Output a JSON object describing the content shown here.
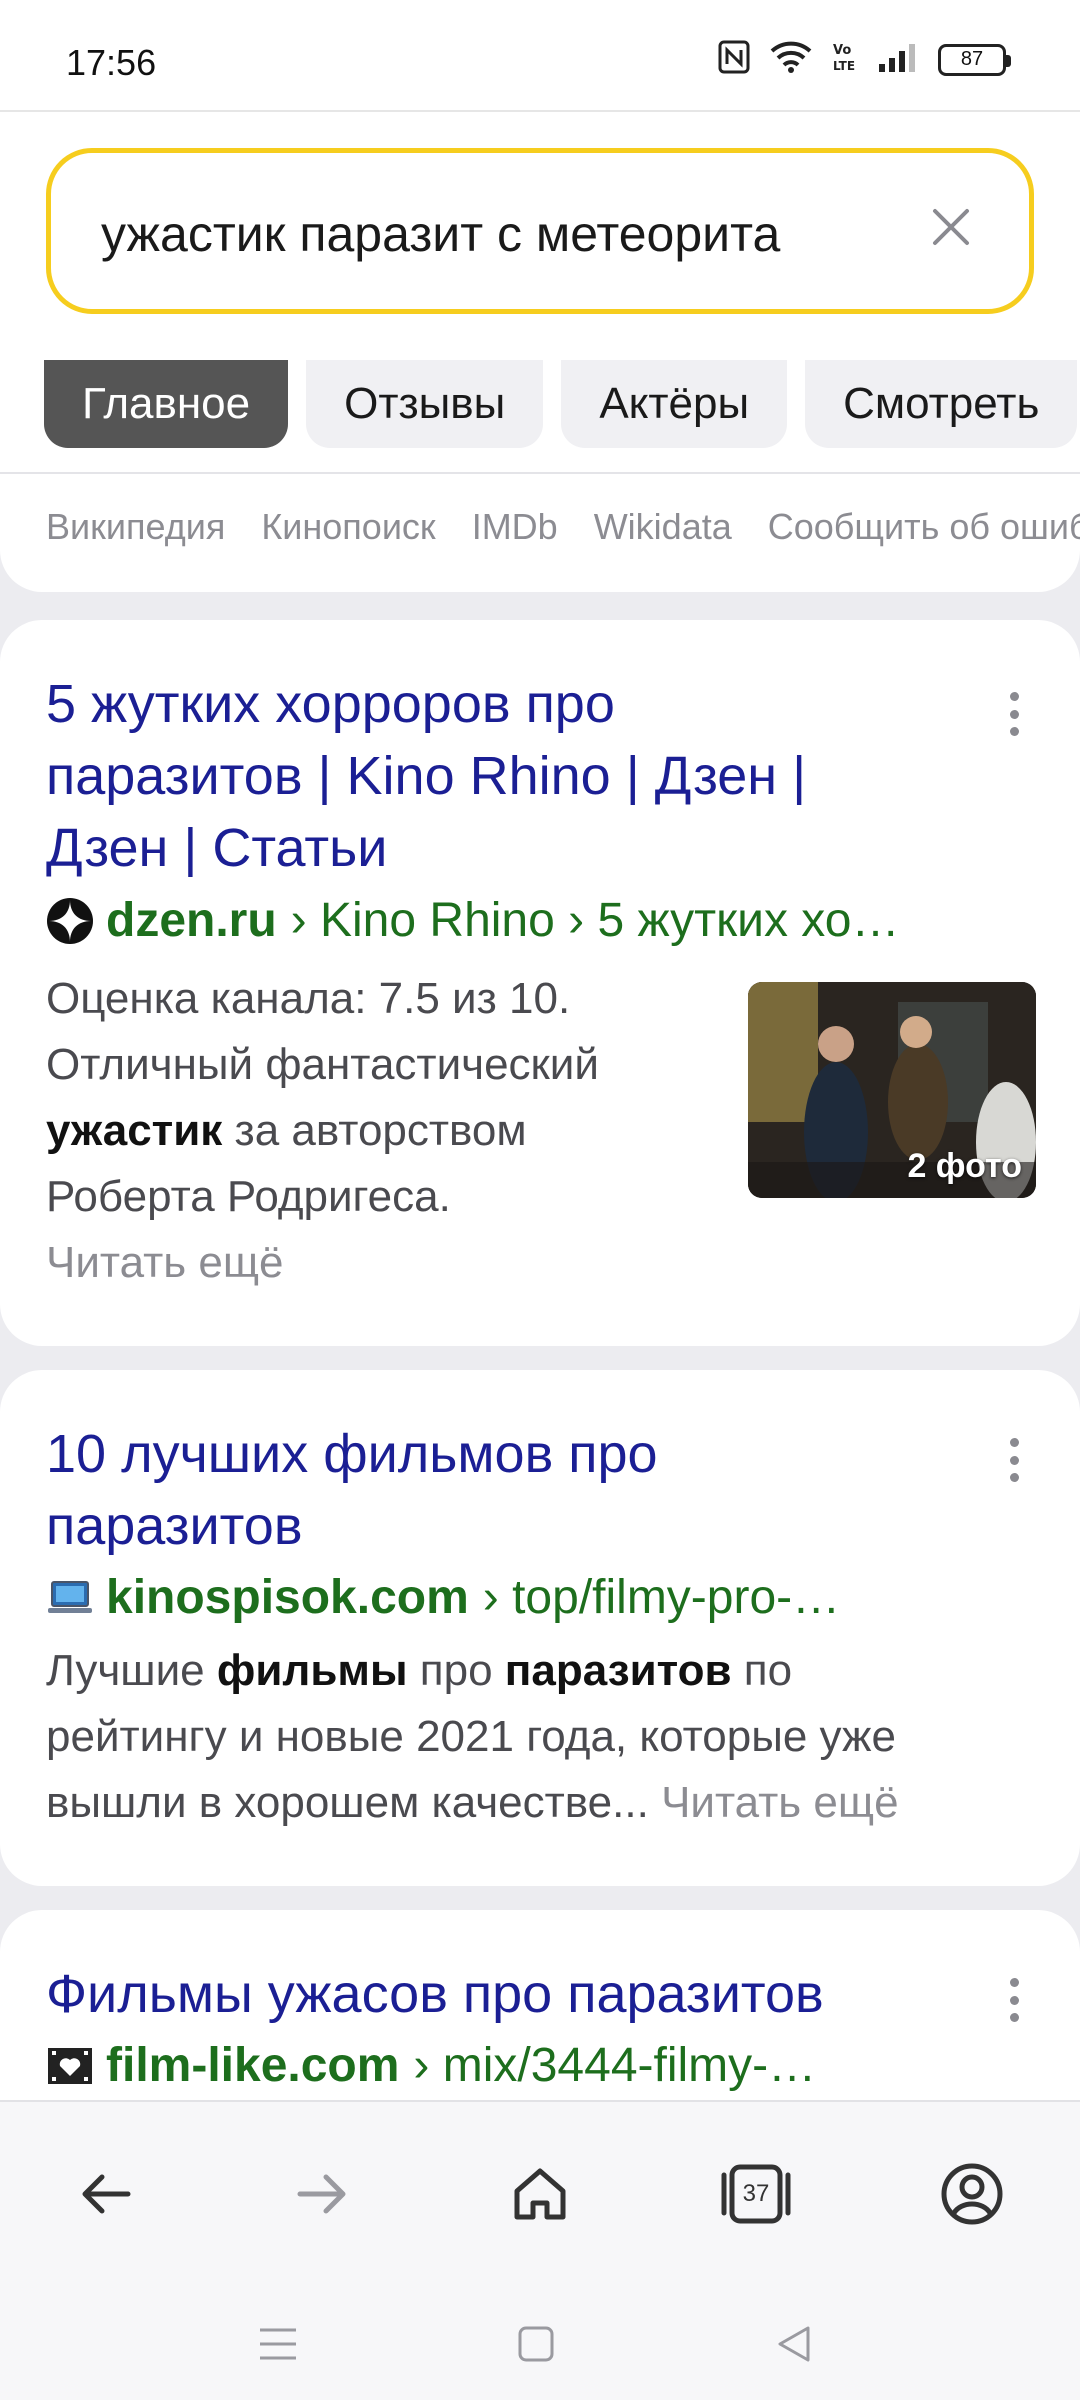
{
  "status_bar": {
    "time": "17:56",
    "battery": "87"
  },
  "search": {
    "query": "ужастик паразит с метеорита"
  },
  "tabs": [
    "Главное",
    "Отзывы",
    "Актёры",
    "Смотреть"
  ],
  "source_links": [
    "Википедия",
    "Кинопоиск",
    "IMDb",
    "Wikidata",
    "Сообщить об ошибке"
  ],
  "results": [
    {
      "title_lines": [
        "5 жутких хорроров про",
        "паразитов | Kino Rhino | Дзен |",
        "Дзен | Статьи"
      ],
      "domain": "dzen.ru",
      "path": "› Kino Rhino › 5 жутких хо…",
      "snippet_lines": [
        "Оценка канала: 7.5 из 10.",
        "Отличный фантастический"
      ],
      "snippet_bold": "ужастик",
      "snippet_after_bold": " за авторством",
      "snippet_last": "Роберта Родригеса.",
      "read_more": "Читать ещё",
      "thumb_badge": "2 фото"
    },
    {
      "title_lines": [
        "10 лучших фильмов про",
        "паразитов"
      ],
      "domain": "kinospisok.com",
      "path": "› top/filmy-pro-…",
      "snippet_p1_a": "Лучшие ",
      "snippet_p1_b": "фильмы",
      "snippet_p1_c": " про ",
      "snippet_p1_d": "паразитов",
      "snippet_p1_e": " по",
      "snippet_line2": "рейтингу и новые 2021 года, которые уже",
      "snippet_line3": "вышли в хорошем качестве... ",
      "read_more": "Читать ещё"
    },
    {
      "title": "Фильмы ужасов про паразитов",
      "domain": "film-like.com",
      "path": "› mix/3444-filmy-…"
    }
  ],
  "bottom_nav": {
    "tabs_count": "37"
  },
  "colors": {
    "accent_yellow": "#f6cd1e",
    "title_blue": "#1b1f94",
    "url_green": "#1d6e1d"
  }
}
